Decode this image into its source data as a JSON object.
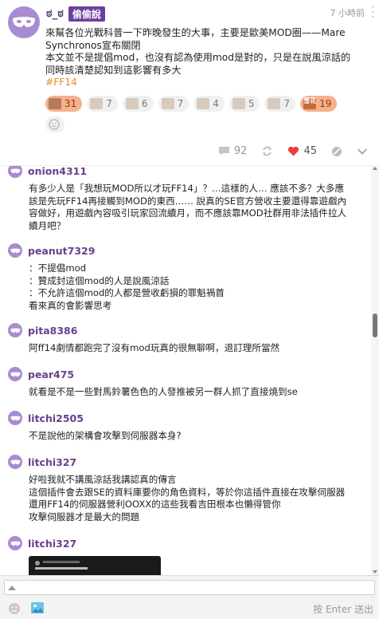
{
  "post": {
    "author": "ಠ_ಠ",
    "board_tag": "偷偷說",
    "time": "7 小時前",
    "lines": [
      "來幫各位光戰科普一下昨晚發生的大事，主要是歐美MOD圈——Mare",
      "Synchronos宣布關閉",
      "本文並不是提倡mod，也沒有認為使用mod是對的，只是在說風涼話的",
      "同時該清楚認知到這影響有多大"
    ],
    "hashtag": "#FF14",
    "reactions": [
      {
        "icon": "cat-photo-emoji-icon",
        "count": "31",
        "active": true
      },
      {
        "icon": "thinking-sketch-emoji-icon",
        "count": "7",
        "active": false
      },
      {
        "icon": "scribble-emoji-icon",
        "count": "6",
        "active": false
      },
      {
        "icon": "doodle-emoji-icon",
        "count": "7",
        "active": false
      },
      {
        "icon": "photo-emoji-icon",
        "count": "4",
        "active": false
      },
      {
        "icon": "face-photo-emoji-icon",
        "count": "5",
        "active": false
      },
      {
        "icon": "eyes-emoji-icon",
        "count": "7",
        "active": false
      }
    ],
    "text_reaction": {
      "label": "雪花",
      "count": "19"
    },
    "comment_count": "92",
    "like_count": "45"
  },
  "comments": [
    {
      "user": "onion4311",
      "lines": [
        "有多少人是「我想玩MOD所以才玩FF14」？…這樣的人… 應該不多？大多應",
        "該是先玩FF14再接觸到MOD的東西…… 說真的SE官方營收主要還得靠遊戲內",
        "容做好，用遊戲內容吸引玩家回流續月，而不應該靠MOD社群用非法插件拉人",
        "續月吧？"
      ]
    },
    {
      "user": "peanut7329",
      "lines": [
        "：不提倡mod",
        "：贊成封這個mod的人是說風涼話",
        "：不允許這個mod的人都是營收虧損的罪魁禍首",
        "看來真的會影響思考"
      ]
    },
    {
      "user": "pita8386",
      "lines": [
        "阿ff14劇情都跑完了沒有mod玩真的很無聊啊，退訂理所當然"
      ]
    },
    {
      "user": "pear475",
      "lines": [
        "就看是不是一些對馬鈴薯色色的人發推被另一群人抓了直接燒到se"
      ]
    },
    {
      "user": "litchi2505",
      "lines": [
        "不是說他的架構會攻擊到伺服器本身?"
      ]
    },
    {
      "user": "litchi327",
      "lines": [
        "好啦我就不講風涼話我講認真的傳言",
        "這個插件會去跟SE的資料庫要你的角色資料，等於你這插件直接在攻擊伺服器",
        "還用FF14的伺服器營利OOXX的這些我看吉田根本也懶得管你",
        "攻擊伺服器才是最大的問題"
      ]
    },
    {
      "user": "litchi327",
      "lines": []
    }
  ],
  "composer": {
    "send_hint": "按 Enter 送出"
  }
}
